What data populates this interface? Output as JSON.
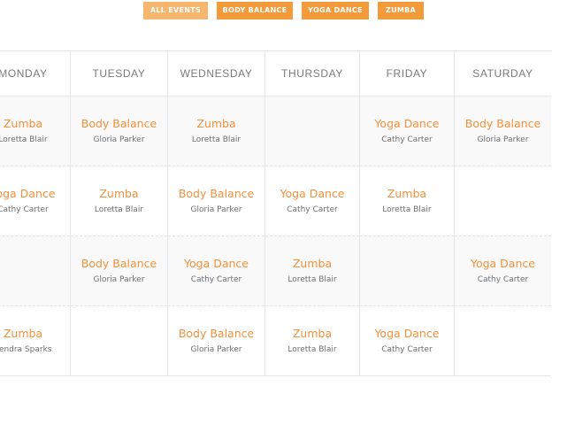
{
  "filters": [
    {
      "label": "ALL EVENTS",
      "active": true
    },
    {
      "label": "BODY BALANCE",
      "active": false
    },
    {
      "label": "YOGA DANCE",
      "active": false
    },
    {
      "label": "ZUMBA",
      "active": false
    }
  ],
  "colors": {
    "accent": "#f39a3b",
    "accent_active": "#f6b66d",
    "event_title": "#f4913b",
    "instructor_text": "#6e6e6e",
    "header_text": "#7a7a7a",
    "grid_line": "#e6e6e6",
    "row_alt_bg": "#f9f9f9"
  },
  "schedule": {
    "days": [
      "MONDAY",
      "TUESDAY",
      "WEDNESDAY",
      "THURSDAY",
      "FRIDAY",
      "SATURDAY"
    ],
    "rows": [
      [
        {
          "title": "Zumba",
          "instructor": "Loretta Blair"
        },
        {
          "title": "Body Balance",
          "instructor": "Gloria Parker"
        },
        {
          "title": "Zumba",
          "instructor": "Loretta Blair"
        },
        {
          "title": "",
          "instructor": ""
        },
        {
          "title": "Yoga Dance",
          "instructor": "Cathy Carter"
        },
        {
          "title": "Body Balance",
          "instructor": "Gloria Parker"
        }
      ],
      [
        {
          "title": "Yoga Dance",
          "instructor": "Cathy Carter"
        },
        {
          "title": "Zumba",
          "instructor": "Loretta Blair"
        },
        {
          "title": "Body Balance",
          "instructor": "Gloria Parker"
        },
        {
          "title": "Yoga Dance",
          "instructor": "Cathy Carter"
        },
        {
          "title": "Zumba",
          "instructor": "Loretta Blair"
        },
        {
          "title": "",
          "instructor": ""
        }
      ],
      [
        {
          "title": "",
          "instructor": ""
        },
        {
          "title": "Body Balance",
          "instructor": "Gloria Parker"
        },
        {
          "title": "Yoga Dance",
          "instructor": "Cathy Carter"
        },
        {
          "title": "Zumba",
          "instructor": "Loretta Blair"
        },
        {
          "title": "",
          "instructor": ""
        },
        {
          "title": "Yoga Dance",
          "instructor": "Cathy Carter"
        }
      ],
      [
        {
          "title": "Zumba",
          "instructor": "Kendra Sparks"
        },
        {
          "title": "",
          "instructor": ""
        },
        {
          "title": "Body Balance",
          "instructor": "Gloria Parker"
        },
        {
          "title": "Zumba",
          "instructor": "Loretta Blair"
        },
        {
          "title": "Yoga Dance",
          "instructor": "Cathy Carter"
        },
        {
          "title": "",
          "instructor": ""
        }
      ]
    ]
  }
}
